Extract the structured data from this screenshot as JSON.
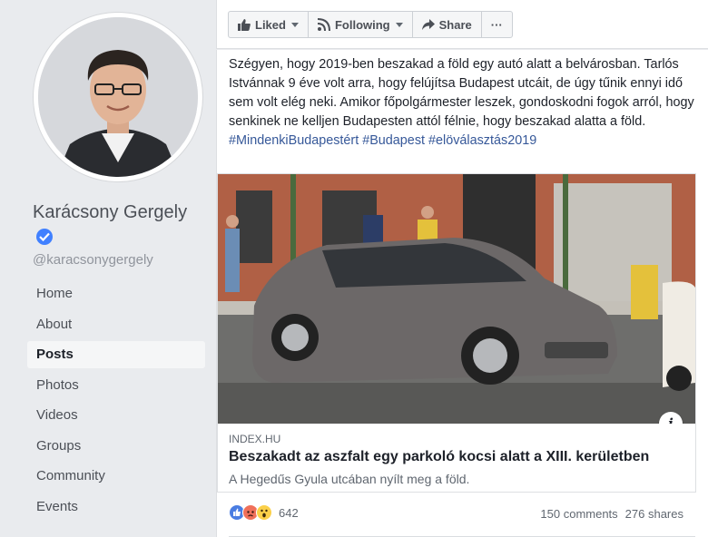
{
  "profile": {
    "name": "Karácsony Gergely",
    "handle": "@karacsonygergely",
    "verified": true
  },
  "nav": {
    "items": [
      {
        "label": "Home",
        "active": false
      },
      {
        "label": "About",
        "active": false
      },
      {
        "label": "Posts",
        "active": true
      },
      {
        "label": "Photos",
        "active": false
      },
      {
        "label": "Videos",
        "active": false
      },
      {
        "label": "Groups",
        "active": false
      },
      {
        "label": "Community",
        "active": false
      },
      {
        "label": "Events",
        "active": false
      }
    ]
  },
  "toolbar": {
    "liked_label": "Liked",
    "following_label": "Following",
    "share_label": "Share",
    "more_label": "···"
  },
  "post": {
    "text": "Szégyen, hogy 2019-ben beszakad a föld egy autó alatt a belvárosban. Tarlós Istvánnak 9 éve volt arra, hogy felújítsa Budapest utcáit, de úgy tűnik ennyi idő sem volt elég neki. Amikor főpolgármester leszek, gondoskodni fogok arról, hogy senkinek ne kelljen Budapesten attól félnie, hogy beszakad alatta a föld.",
    "hashtags": "#MindenkiBudapestért #Budapest #elöválasztás2019",
    "link": {
      "domain": "INDEX.HU",
      "title": "Beszakadt az aszfalt egy parkoló kocsi alatt a XIII. kerületben",
      "description": "A Hegedűs Gyula utcában nyílt meg a föld.",
      "info_icon": "i"
    },
    "reactions": {
      "types": [
        "like",
        "angry",
        "wow"
      ],
      "count": "642"
    },
    "comments": "150 comments",
    "shares": "276 shares"
  },
  "colors": {
    "link_blue": "#365899",
    "verified_blue": "#4080ff",
    "page_bg": "#e9ebee"
  }
}
